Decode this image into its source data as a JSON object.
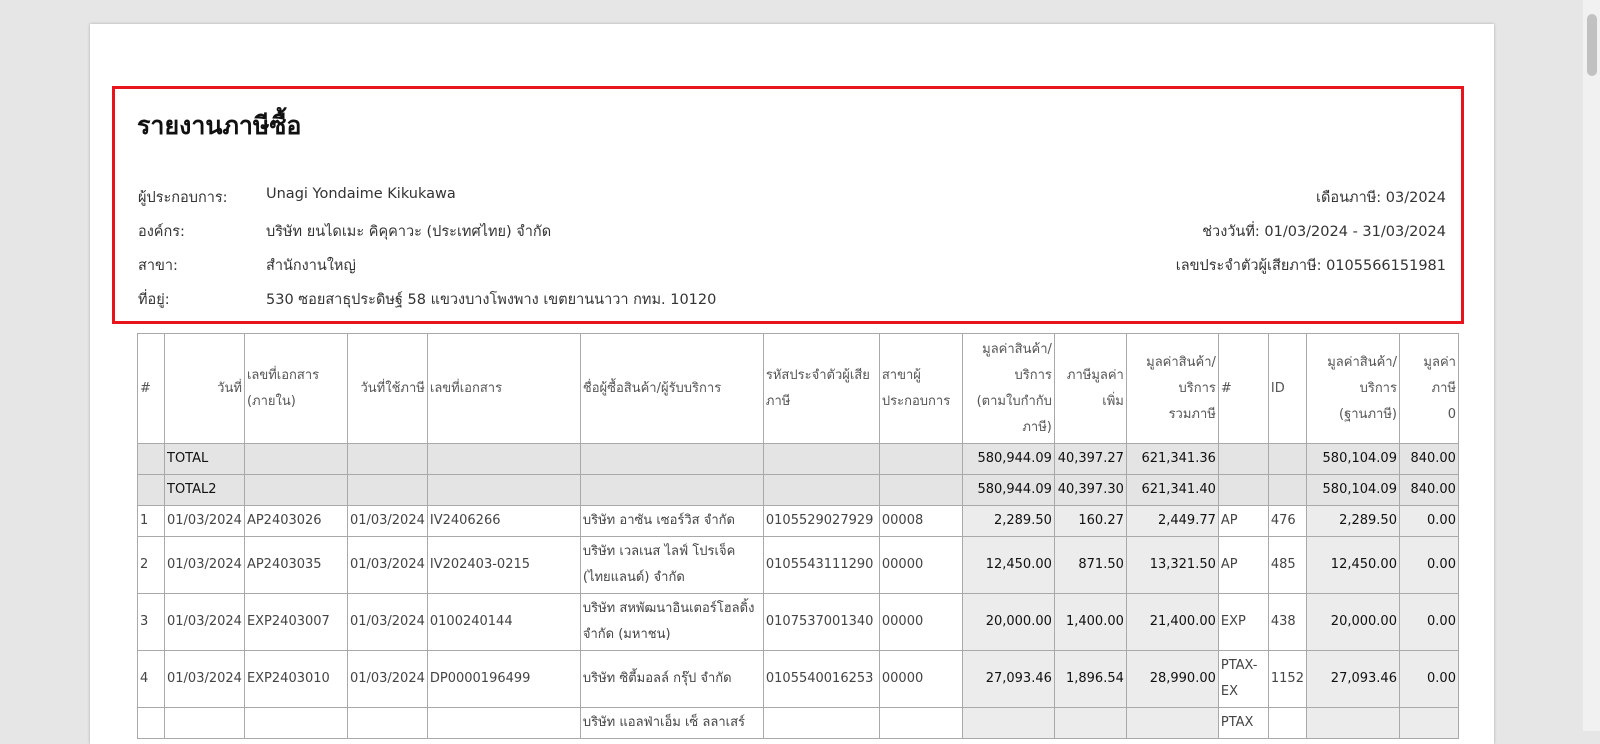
{
  "report": {
    "title": "รายงานภาษีซื้อ",
    "operator_label": "ผู้ประกอบการ:",
    "operator_value": "Unagi Yondaime Kikukawa",
    "org_label": "องค์กร:",
    "org_value": "บริษัท ยนไดเมะ คิคุคาวะ (ประเทศไทย) จำกัด",
    "branch_label": "สาขา:",
    "branch_value": "สำนักงานใหญ่",
    "address_label": "ที่อยู่:",
    "address_value": "530 ซอยสาธุประดิษฐ์ 58 แขวงบางโพงพาง เขตยานนาวา กทม. 10120",
    "tax_month": "เดือนภาษี: 03/2024",
    "date_range": "ช่วงวันที่: 01/03/2024 - 31/03/2024",
    "tax_id": "เลขประจำตัวผู้เสียภาษี: 0105566151981"
  },
  "table": {
    "headers": [
      "#",
      "วันที่",
      "เลขที่เอกสาร\n(ภายใน)",
      "วันที่ใช้ภาษี",
      "เลขที่เอกสาร",
      "ชื่อผู้ซื้อสินค้า/ผู้รับบริการ",
      "รหัสประจำตัวผู้เสีย\nภาษี",
      "สาขาผู้\nประกอบการ",
      "มูลค่าสินค้า/\nบริการ\n(ตามใบกำกับ\nภาษี)",
      "ภาษีมูลค่า\nเพิ่ม",
      "มูลค่าสินค้า/\nบริการ\nรวมภาษี",
      "#",
      "ID",
      "มูลค่าสินค้า/\nบริการ\n(ฐานภาษี)",
      "มูลค่าภาษี\n0"
    ],
    "totals": [
      {
        "label": "TOTAL",
        "value": "580,944.09",
        "vat": "40,397.27",
        "total": "621,341.36",
        "base": "580,104.09",
        "zero": "840.00"
      },
      {
        "label": "TOTAL2",
        "value": "580,944.09",
        "vat": "40,397.30",
        "total": "621,341.40",
        "base": "580,104.09",
        "zero": "840.00"
      }
    ],
    "rows": [
      {
        "no": "1",
        "date": "01/03/2024",
        "internal_doc": "AP2403026",
        "tax_date": "01/03/2024",
        "doc_no": "IV2406266",
        "vendor": "บริษัท อาซัน เซอร์วิส จำกัด",
        "tax_id": "0105529027929",
        "branch": "00008",
        "value": "2,289.50",
        "vat": "160.27",
        "total": "2,449.77",
        "type": "AP",
        "id": "476",
        "base": "2,289.50",
        "zero": "0.00"
      },
      {
        "no": "2",
        "date": "01/03/2024",
        "internal_doc": "AP2403035",
        "tax_date": "01/03/2024",
        "doc_no": "IV202403-0215",
        "vendor": "บริษัท เวลเนส ไลฟ์ โปรเจ็ค (ไทยแลนด์) จำกัด",
        "tax_id": "0105543111290",
        "branch": "00000",
        "value": "12,450.00",
        "vat": "871.50",
        "total": "13,321.50",
        "type": "AP",
        "id": "485",
        "base": "12,450.00",
        "zero": "0.00"
      },
      {
        "no": "3",
        "date": "01/03/2024",
        "internal_doc": "EXP2403007",
        "tax_date": "01/03/2024",
        "doc_no": "0100240144",
        "vendor": "บริษัท สหพัฒนาอินเตอร์โฮลดิ้ง จำกัด (มหาชน)",
        "tax_id": "0107537001340",
        "branch": "00000",
        "value": "20,000.00",
        "vat": "1,400.00",
        "total": "21,400.00",
        "type": "EXP",
        "id": "438",
        "base": "20,000.00",
        "zero": "0.00"
      },
      {
        "no": "4",
        "date": "01/03/2024",
        "internal_doc": "EXP2403010",
        "tax_date": "01/03/2024",
        "doc_no": "DP0000196499",
        "vendor": "บริษัท ซิตี้มอลล์ กรุ๊ป จำกัด",
        "tax_id": "0105540016253",
        "branch": "00000",
        "value": "27,093.46",
        "vat": "1,896.54",
        "total": "28,990.00",
        "type": "PTAX-EX",
        "id": "1152",
        "base": "27,093.46",
        "zero": "0.00"
      }
    ],
    "partial_row": {
      "vendor": "บริษัท แอลฟ่าเอ็ม เซ็ ลลาเสร์",
      "type": "PTAX"
    }
  },
  "colors": {
    "highlight": "#e8141b",
    "total_bg": "#e4e4e4"
  }
}
